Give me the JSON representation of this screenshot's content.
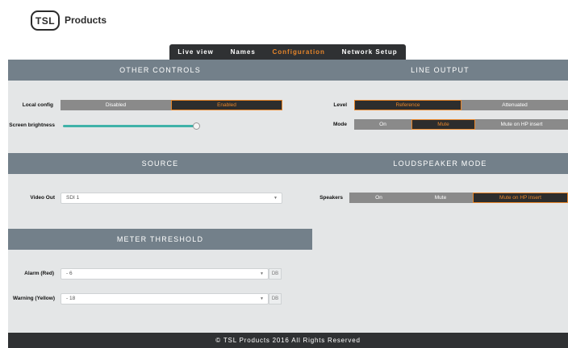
{
  "brand": {
    "logo_text": "TSL",
    "name": "Products"
  },
  "nav": {
    "tabs": [
      {
        "label": "Live view"
      },
      {
        "label": "Names"
      },
      {
        "label": "Configuration",
        "active": true
      },
      {
        "label": "Network Setup"
      }
    ]
  },
  "sections": {
    "other_controls": {
      "title": "OTHER CONTROLS",
      "local_config": {
        "label": "Local config",
        "options": [
          "Disabled",
          "Enabled"
        ],
        "selected": "Enabled"
      },
      "screen_brightness": {
        "label": "Screen brightness",
        "value_fraction": 0.98
      }
    },
    "line_output": {
      "title": "LINE OUTPUT",
      "level": {
        "label": "Level",
        "options": [
          "Reference",
          "Attenuated"
        ],
        "selected": "Reference"
      },
      "mode": {
        "label": "Mode",
        "options": [
          "On",
          "Mute",
          "Mute on HP insert"
        ],
        "selected": "Mute"
      }
    },
    "source": {
      "title": "SOURCE",
      "video_out": {
        "label": "Video Out",
        "value": "SDI 1"
      }
    },
    "loudspeaker_mode": {
      "title": "LOUDSPEAKER MODE",
      "speakers": {
        "label": "Speakers",
        "options": [
          "On",
          "Mute",
          "Mute on HP insert"
        ],
        "selected": "Mute on HP insert"
      }
    },
    "meter_threshold": {
      "title": "METER THRESHOLD",
      "alarm": {
        "label": "Alarm (Red)",
        "value": "- 6",
        "unit": "DB"
      },
      "warning": {
        "label": "Warning (Yellow)",
        "value": "- 18",
        "unit": "DB"
      }
    }
  },
  "footer": {
    "text": "© TSL Products 2016 All Rights Reserved"
  },
  "colors": {
    "accent": "#e8862a",
    "header": "#73808a",
    "dark": "#2f3133",
    "slider": "#3fb2a8"
  }
}
